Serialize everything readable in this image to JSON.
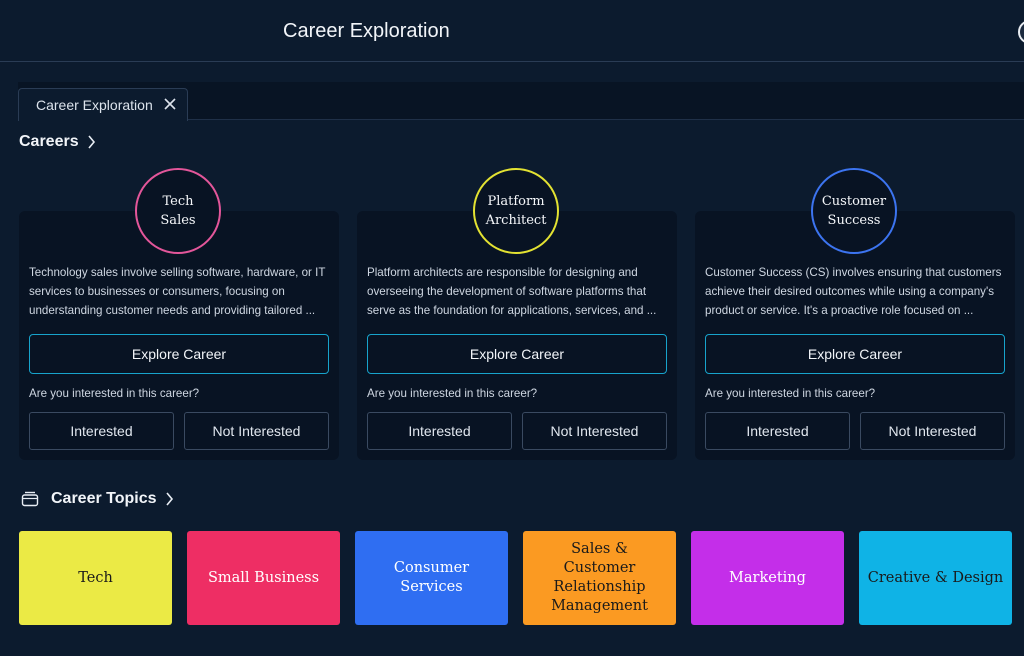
{
  "header": {
    "title": "Career Exploration"
  },
  "tab": {
    "label": "Career Exploration"
  },
  "careers_section": {
    "label": "Careers"
  },
  "careers": [
    {
      "name": "Tech Sales",
      "ring_color": "#e3569a",
      "description": "Technology sales involve selling software, hardware, or IT services to businesses or consumers, focusing on understanding customer needs and providing tailored ...",
      "explore_label": "Explore Career",
      "question": "Are you interested in this career?",
      "interested_label": "Interested",
      "not_interested_label": "Not Interested"
    },
    {
      "name": "Platform Architect",
      "ring_color": "#e3e232",
      "description": "Platform architects are responsible for designing and overseeing the development of software platforms that serve as the foundation for applications, services, and ...",
      "explore_label": "Explore Career",
      "question": "Are you interested in this career?",
      "interested_label": "Interested",
      "not_interested_label": "Not Interested"
    },
    {
      "name": "Customer Success",
      "ring_color": "#3c74f0",
      "description": "Customer Success (CS) involves ensuring that customers achieve their desired outcomes while using a company's product or service. It's a proactive role focused on ...",
      "explore_label": "Explore Career",
      "question": "Are you interested in this career?",
      "interested_label": "Interested",
      "not_interested_label": "Not Interested"
    }
  ],
  "topics_section": {
    "label": "Career Topics"
  },
  "topics": [
    {
      "label": "Tech",
      "bg": "#ebea45",
      "fg": "#1a1a1a"
    },
    {
      "label": "Small Business",
      "bg": "#ee2e64",
      "fg": "#ffffff"
    },
    {
      "label": "Consumer Services",
      "bg": "#2f6ef2",
      "fg": "#ffffff"
    },
    {
      "label": "Sales & Customer Relationship Management",
      "bg": "#fb9a22",
      "fg": "#1a1a1a"
    },
    {
      "label": "Marketing",
      "bg": "#c42ee9",
      "fg": "#ffffff"
    },
    {
      "label": "Creative & Design",
      "bg": "#0fb3e6",
      "fg": "#1a1a1a"
    }
  ]
}
